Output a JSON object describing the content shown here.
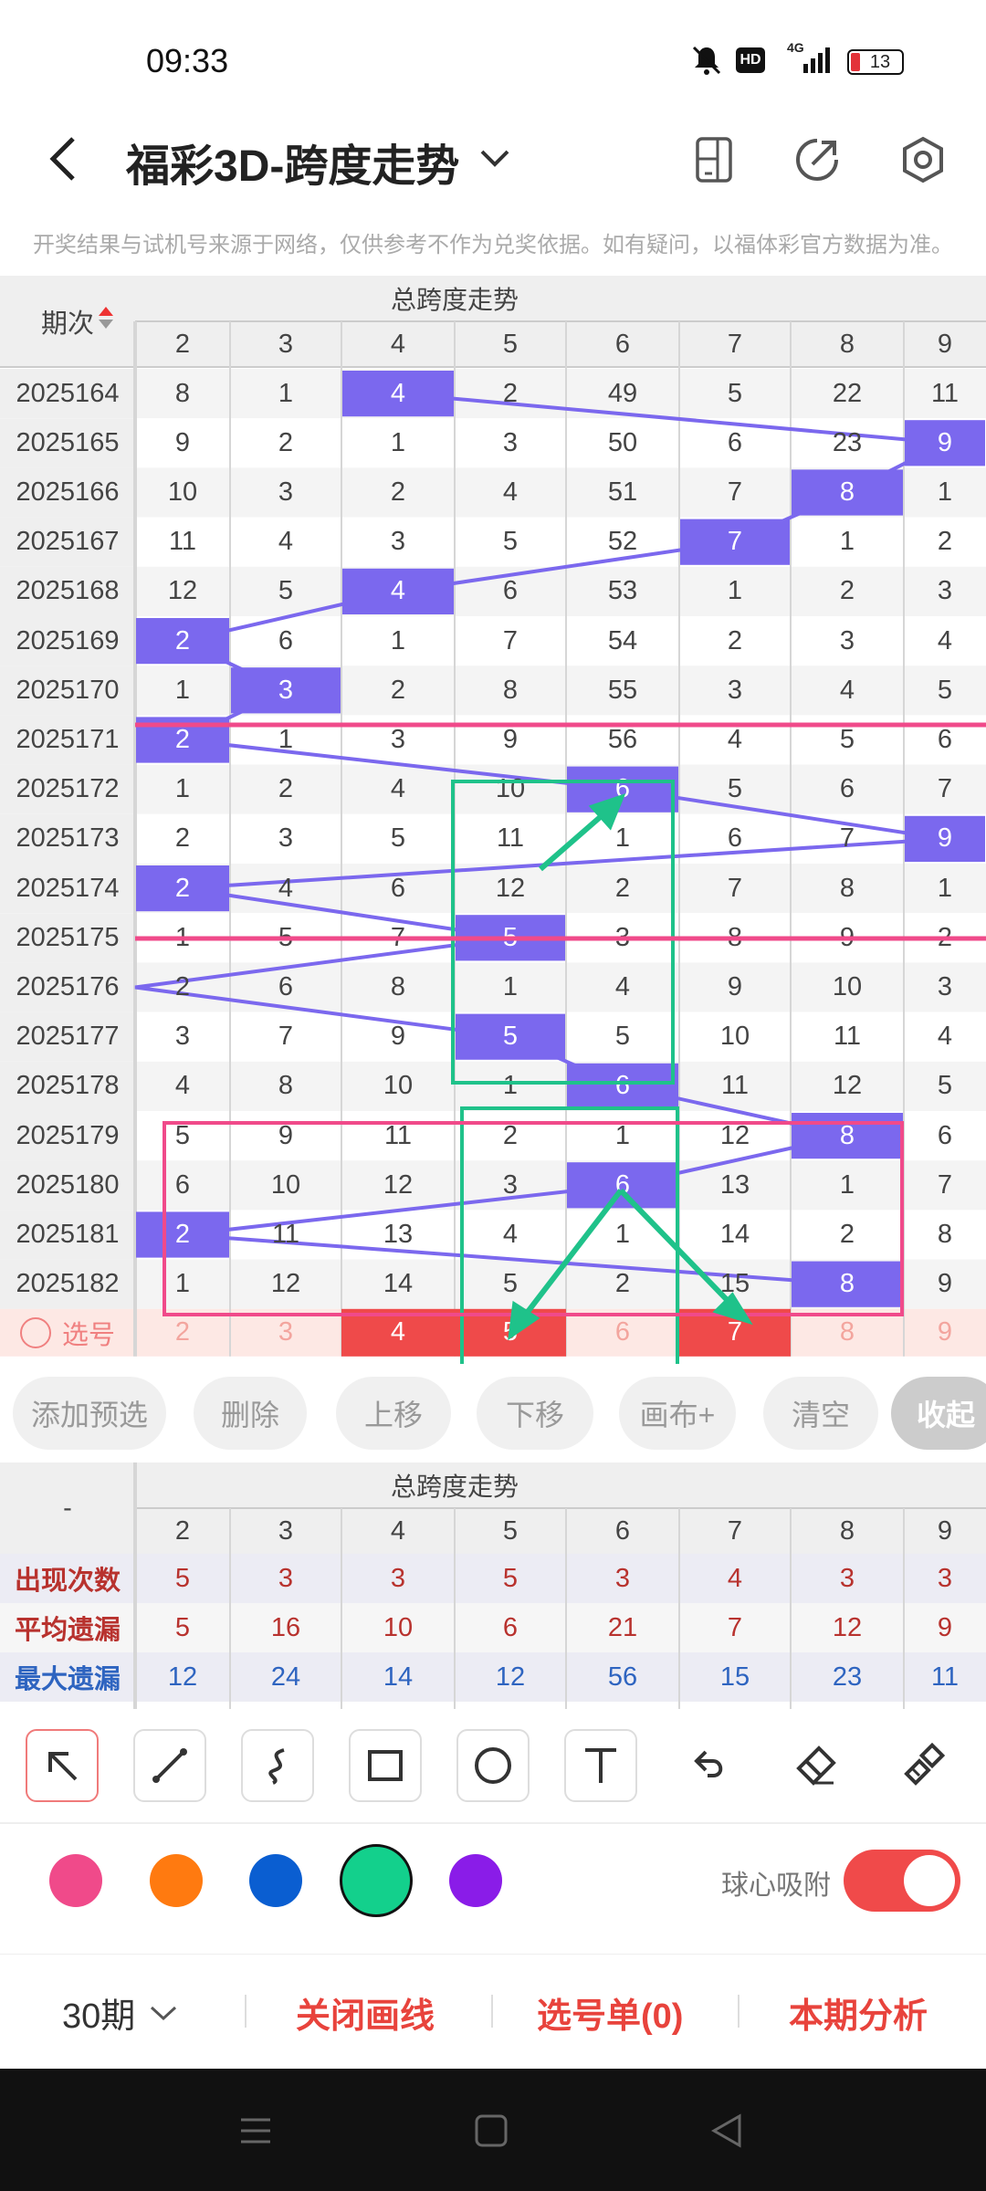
{
  "status": {
    "time": "09:33",
    "battery": "13",
    "signal": "4G",
    "hd": "HD"
  },
  "header": {
    "title": "福彩3D-跨度走势"
  },
  "notice": "开奖结果与试机号来源于网络，仅供参考不作为兑奖依据。如有疑问，以福体彩官方数据为准。",
  "table": {
    "period_header": "期次",
    "section_title": "总跨度走势",
    "columns": [
      "2",
      "3",
      "4",
      "5",
      "6",
      "7",
      "8",
      "9"
    ],
    "rows": [
      {
        "period": "2025164",
        "cells": [
          "8",
          "1",
          "4",
          "2",
          "49",
          "5",
          "22",
          "11"
        ],
        "hit": 2
      },
      {
        "period": "2025165",
        "cells": [
          "9",
          "2",
          "1",
          "3",
          "50",
          "6",
          "23",
          "9"
        ],
        "hit": 7
      },
      {
        "period": "2025166",
        "cells": [
          "10",
          "3",
          "2",
          "4",
          "51",
          "7",
          "8",
          "1"
        ],
        "hit": 6
      },
      {
        "period": "2025167",
        "cells": [
          "11",
          "4",
          "3",
          "5",
          "52",
          "7",
          "1",
          "2"
        ],
        "hit": 5
      },
      {
        "period": "2025168",
        "cells": [
          "12",
          "5",
          "4",
          "6",
          "53",
          "1",
          "2",
          "3"
        ],
        "hit": 2
      },
      {
        "period": "2025169",
        "cells": [
          "2",
          "6",
          "1",
          "7",
          "54",
          "2",
          "3",
          "4"
        ],
        "hit": 0
      },
      {
        "period": "2025170",
        "cells": [
          "1",
          "3",
          "2",
          "8",
          "55",
          "3",
          "4",
          "5"
        ],
        "hit": 1
      },
      {
        "period": "2025171",
        "cells": [
          "2",
          "1",
          "3",
          "9",
          "56",
          "4",
          "5",
          "6"
        ],
        "hit": 0
      },
      {
        "period": "2025172",
        "cells": [
          "1",
          "2",
          "4",
          "10",
          "6",
          "5",
          "6",
          "7"
        ],
        "hit": 4
      },
      {
        "period": "2025173",
        "cells": [
          "2",
          "3",
          "5",
          "11",
          "1",
          "6",
          "7",
          "9"
        ],
        "hit": 7
      },
      {
        "period": "2025174",
        "cells": [
          "2",
          "4",
          "6",
          "12",
          "2",
          "7",
          "8",
          "1"
        ],
        "hit": 0
      },
      {
        "period": "2025175",
        "cells": [
          "1",
          "5",
          "7",
          "5",
          "3",
          "8",
          "9",
          "2"
        ],
        "hit": 3
      },
      {
        "period": "2025176",
        "cells": [
          "2",
          "6",
          "8",
          "1",
          "4",
          "9",
          "10",
          "3"
        ],
        "hit": -1
      },
      {
        "period": "2025177",
        "cells": [
          "3",
          "7",
          "9",
          "5",
          "5",
          "10",
          "11",
          "4"
        ],
        "hit": 3
      },
      {
        "period": "2025178",
        "cells": [
          "4",
          "8",
          "10",
          "1",
          "6",
          "11",
          "12",
          "5"
        ],
        "hit": 4
      },
      {
        "period": "2025179",
        "cells": [
          "5",
          "9",
          "11",
          "2",
          "1",
          "12",
          "8",
          "6"
        ],
        "hit": 6
      },
      {
        "period": "2025180",
        "cells": [
          "6",
          "10",
          "12",
          "3",
          "6",
          "13",
          "1",
          "7"
        ],
        "hit": 4
      },
      {
        "period": "2025181",
        "cells": [
          "2",
          "11",
          "13",
          "4",
          "1",
          "14",
          "2",
          "8"
        ],
        "hit": 0
      },
      {
        "period": "2025182",
        "cells": [
          "1",
          "12",
          "14",
          "5",
          "2",
          "15",
          "8",
          "9"
        ],
        "hit": 6
      }
    ],
    "select_label": "选号",
    "select_row": [
      "2",
      "3",
      "4",
      "5",
      "6",
      "7",
      "8",
      "9"
    ],
    "selected": [
      2,
      3,
      5
    ]
  },
  "buttons": [
    "添加预选",
    "删除",
    "上移",
    "下移",
    "画布+",
    "清空",
    "收起"
  ],
  "stats": {
    "section_title": "总跨度走势",
    "corner": "-",
    "columns": [
      "2",
      "3",
      "4",
      "5",
      "6",
      "7",
      "8",
      "9"
    ],
    "rows": [
      {
        "label": "出现次数",
        "values": [
          "5",
          "3",
          "3",
          "5",
          "3",
          "4",
          "3",
          "3"
        ],
        "color": "#b8322e"
      },
      {
        "label": "平均遗漏",
        "values": [
          "5",
          "16",
          "10",
          "6",
          "21",
          "7",
          "12",
          "9"
        ],
        "color": "#b8322e"
      },
      {
        "label": "最大遗漏",
        "values": [
          "12",
          "24",
          "14",
          "12",
          "56",
          "15",
          "23",
          "11"
        ],
        "color": "#2e64c0"
      }
    ]
  },
  "tools": [
    "arrow-tool",
    "line-tool",
    "curve-tool",
    "rect-tool",
    "circle-tool",
    "text-tool",
    "undo-tool",
    "eraser-tool",
    "clear-brush-tool"
  ],
  "colors": [
    "#f04a8a",
    "#ff7a10",
    "#0a5ed1",
    "#13d08c",
    "#8a1ce8"
  ],
  "selected_color": "#13d08c",
  "snap": {
    "label": "球心吸附",
    "on": true
  },
  "bottom": {
    "period_select": "30期",
    "close_lines": "关闭画线",
    "pick_list": "选号单(0)",
    "analysis": "本期分析"
  },
  "hit_color": "#7b68ee"
}
